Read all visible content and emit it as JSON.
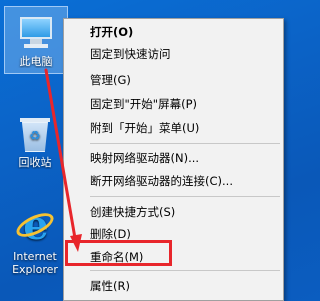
{
  "desktop": {
    "icons": [
      {
        "label": "此电脑",
        "icon": "this-pc-icon"
      },
      {
        "label": "回收站",
        "icon": "recycle-bin-icon"
      },
      {
        "label": "Internet Explorer",
        "icon": "internet-explorer-icon"
      }
    ]
  },
  "context_menu": {
    "items": [
      {
        "label": "打开(O)",
        "bold": true
      },
      {
        "label": "固定到快速访问"
      },
      {
        "label": "管理(G)"
      },
      {
        "label": "固定到\"开始\"屏幕(P)"
      },
      {
        "label": "附到「开始」菜单(U)"
      },
      {
        "label": "映射网络驱动器(N)..."
      },
      {
        "label": "断开网络驱动器的连接(C)..."
      },
      {
        "label": "创建快捷方式(S)"
      },
      {
        "label": "删除(D)"
      },
      {
        "label": "重命名(M)"
      },
      {
        "label": "属性(R)"
      }
    ]
  },
  "annotation": {
    "arrow_color": "#e8262b",
    "highlight_color": "#e8262b"
  }
}
